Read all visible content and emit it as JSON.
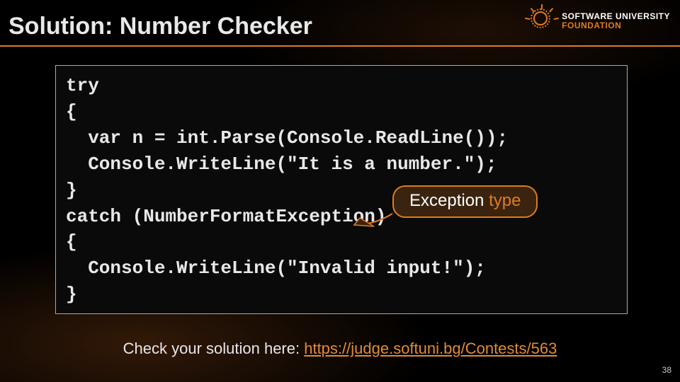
{
  "title": "Solution: Number Checker",
  "logo": {
    "line1": "SOFTWARE UNIVERSITY",
    "line2": "FOUNDATION"
  },
  "code": {
    "l1": "try",
    "l2": "{",
    "l3": "  var n = int.Parse(Console.ReadLine());",
    "l4": "  Console.WriteLine(\"It is a number.\");",
    "l5": "}",
    "l6": "catch (NumberFormatException)",
    "l7": "{",
    "l8": "  Console.WriteLine(\"Invalid input!\");",
    "l9": "}"
  },
  "callout": {
    "text_pre": "Exception ",
    "text_em": "type"
  },
  "footer": {
    "prefix": "Check your solution here: ",
    "link_text": "https://judge.softuni.bg/Contests/563",
    "link_href": "https://judge.softuni.bg/Contests/563"
  },
  "page_number": "38"
}
